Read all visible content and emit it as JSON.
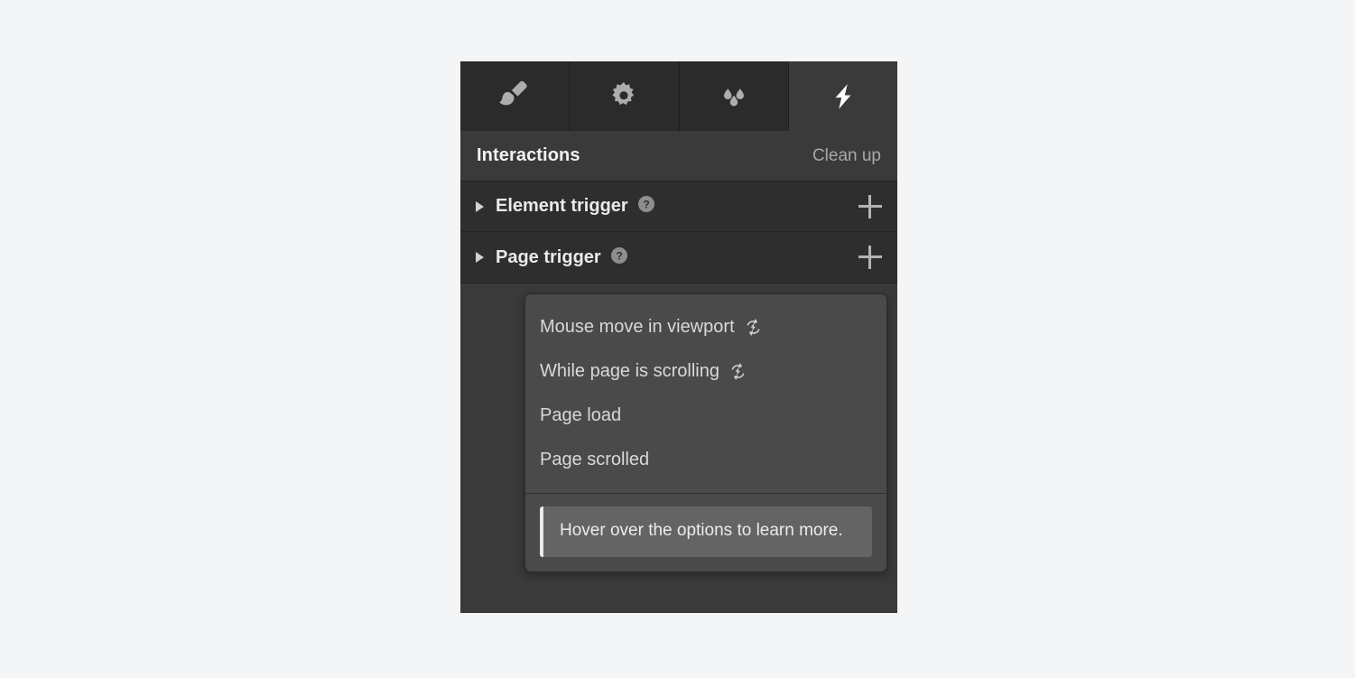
{
  "panel": {
    "tabs": [
      {
        "id": "style",
        "icon": "paintbrush-icon",
        "active": false
      },
      {
        "id": "settings",
        "icon": "gear-icon",
        "active": false
      },
      {
        "id": "effects",
        "icon": "water-drops-icon",
        "active": false
      },
      {
        "id": "interactions",
        "icon": "lightning-bolt-icon",
        "active": true
      }
    ],
    "header": {
      "title": "Interactions",
      "cleanup_label": "Clean up"
    },
    "triggers": [
      {
        "label": "Element trigger",
        "help_icon": "question-mark-icon",
        "add_icon": "plus-icon",
        "disclosure": "collapsed"
      },
      {
        "label": "Page trigger",
        "help_icon": "question-mark-icon",
        "add_icon": "plus-icon",
        "disclosure": "collapsed"
      }
    ],
    "dropdown": {
      "options": [
        {
          "label": "Mouse move in viewport",
          "badge": "loop-lightning-icon"
        },
        {
          "label": "While page is scrolling",
          "badge": "loop-lightning-icon"
        },
        {
          "label": "Page load",
          "badge": null
        },
        {
          "label": "Page scrolled",
          "badge": null
        }
      ],
      "hint": "Hover over the options to learn more."
    }
  },
  "colors": {
    "page_background": "#f4f5f7",
    "panel_background": "#3a3a3a",
    "tabstrip_background": "#2b2b2b",
    "tab_active_background": "#3a3a3a",
    "trigger_row_background": "#2e2e2e",
    "dropdown_background": "#4a4a4a",
    "hint_background": "#646464",
    "hint_accent": "#e9e9e9",
    "text_primary": "#eaeaea",
    "text_secondary": "#a8a8a8",
    "icon_inactive": "#adadad",
    "icon_active": "#ffffff"
  }
}
